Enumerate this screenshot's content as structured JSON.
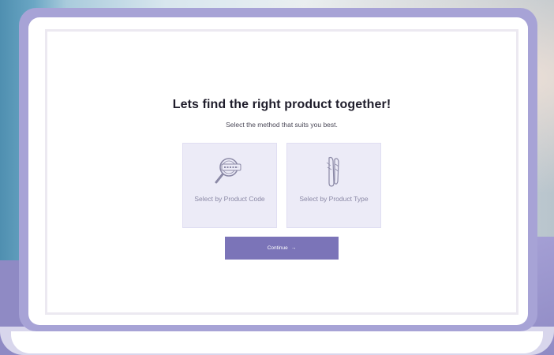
{
  "finder": {
    "title": "Lets find the right product together!",
    "subtitle": "Select the method that suits you best.",
    "options": [
      {
        "label": "Select by Product Code",
        "icon": "magnifier-code-icon"
      },
      {
        "label": "Select by Product Type",
        "icon": "nail-products-icon"
      }
    ],
    "continue_label": "Continue",
    "continue_icon": "→"
  },
  "colors": {
    "accent": "#7b74b8",
    "laptop_frame": "#a7a3d6",
    "option_bg": "#ecebf7",
    "option_label": "#8b89a6",
    "background_band": "#8f8ac4"
  }
}
